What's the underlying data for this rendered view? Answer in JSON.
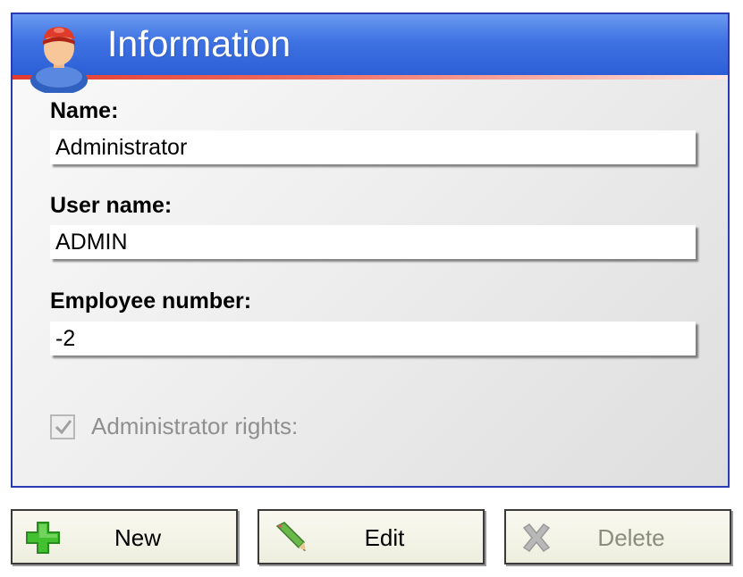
{
  "panel": {
    "title": "Information",
    "icon": "user-icon"
  },
  "fields": [
    {
      "label": "Name:",
      "value": "Administrator"
    },
    {
      "label": "User name:",
      "value": "ADMIN"
    },
    {
      "label": "Employee number:",
      "value": "-2"
    }
  ],
  "admin_rights": {
    "label": "Administrator rights:",
    "checked": true,
    "disabled": true
  },
  "buttons": {
    "new": {
      "label": "New",
      "icon": "plus-icon"
    },
    "edit": {
      "label": "Edit",
      "icon": "pencil-icon"
    },
    "delete": {
      "label": "Delete",
      "icon": "x-icon",
      "disabled": true
    }
  },
  "colors": {
    "header_blue": "#3e72e2",
    "header_accent": "#e23a2e",
    "panel_border": "#2a3ab5"
  }
}
